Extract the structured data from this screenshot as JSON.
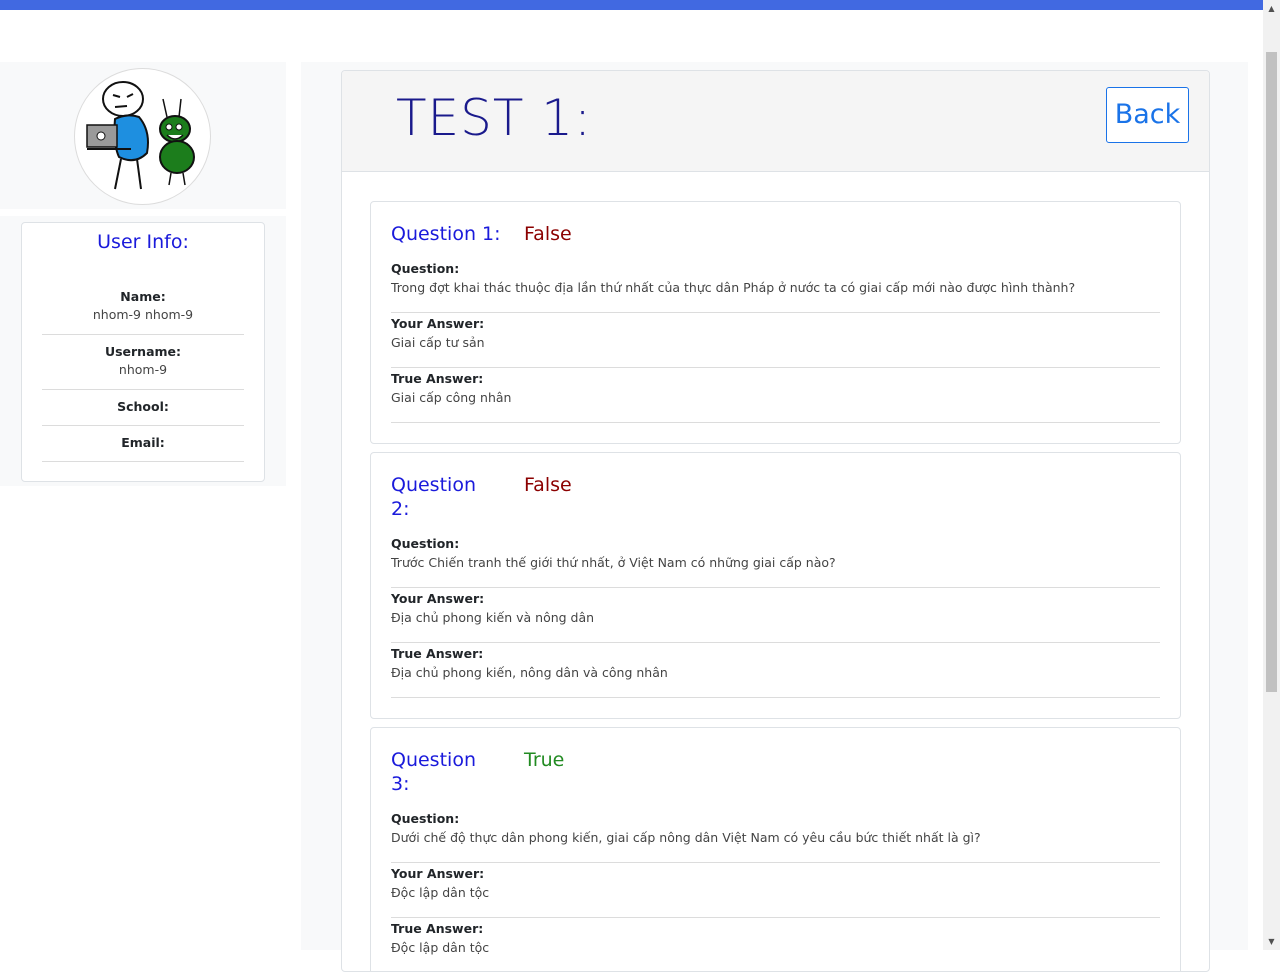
{
  "colors": {
    "topbar": "#4169e1",
    "accent_blue": "#1a1adb",
    "false": "#8b0000",
    "true": "#228b22",
    "back": "#1a73e8"
  },
  "user_info": {
    "title": "User Info:",
    "name_label": "Name:",
    "name_value": "nhom-9 nhom-9",
    "username_label": "Username:",
    "username_value": "nhom-9",
    "school_label": "School:",
    "email_label": "Email:"
  },
  "test": {
    "title": "TEST 1:",
    "back_label": "Back"
  },
  "questions": [
    {
      "title": "Question 1:",
      "result": "False",
      "question_label": "Question:",
      "question_text": "Trong đợt khai thác thuộc địa lần thứ nhất của thực dân Pháp ở nước ta có giai cấp mới nào được hình thành?",
      "your_answer_label": "Your Answer:",
      "your_answer": "Giai cấp tư sản",
      "true_answer_label": "True Answer:",
      "true_answer": "Giai cấp công nhân"
    },
    {
      "title": "Question 2:",
      "result": "False",
      "question_label": "Question:",
      "question_text": "Trước Chiến tranh thế giới thứ nhất, ở Việt Nam có những giai cấp nào?",
      "your_answer_label": "Your Answer:",
      "your_answer": "Địa chủ phong kiến và nông dân",
      "true_answer_label": "True Answer:",
      "true_answer": "Địa chủ phong kiến, nông dân và công nhân"
    },
    {
      "title": "Question 3:",
      "result": "True",
      "question_label": "Question:",
      "question_text": "Dưới chế độ thực dân phong kiến, giai cấp nông dân Việt Nam có yêu cầu bức thiết nhất là gì?",
      "your_answer_label": "Your Answer:",
      "your_answer": "Độc lập dân tộc",
      "true_answer_label": "True Answer:",
      "true_answer": "Độc lập dân tộc"
    }
  ]
}
